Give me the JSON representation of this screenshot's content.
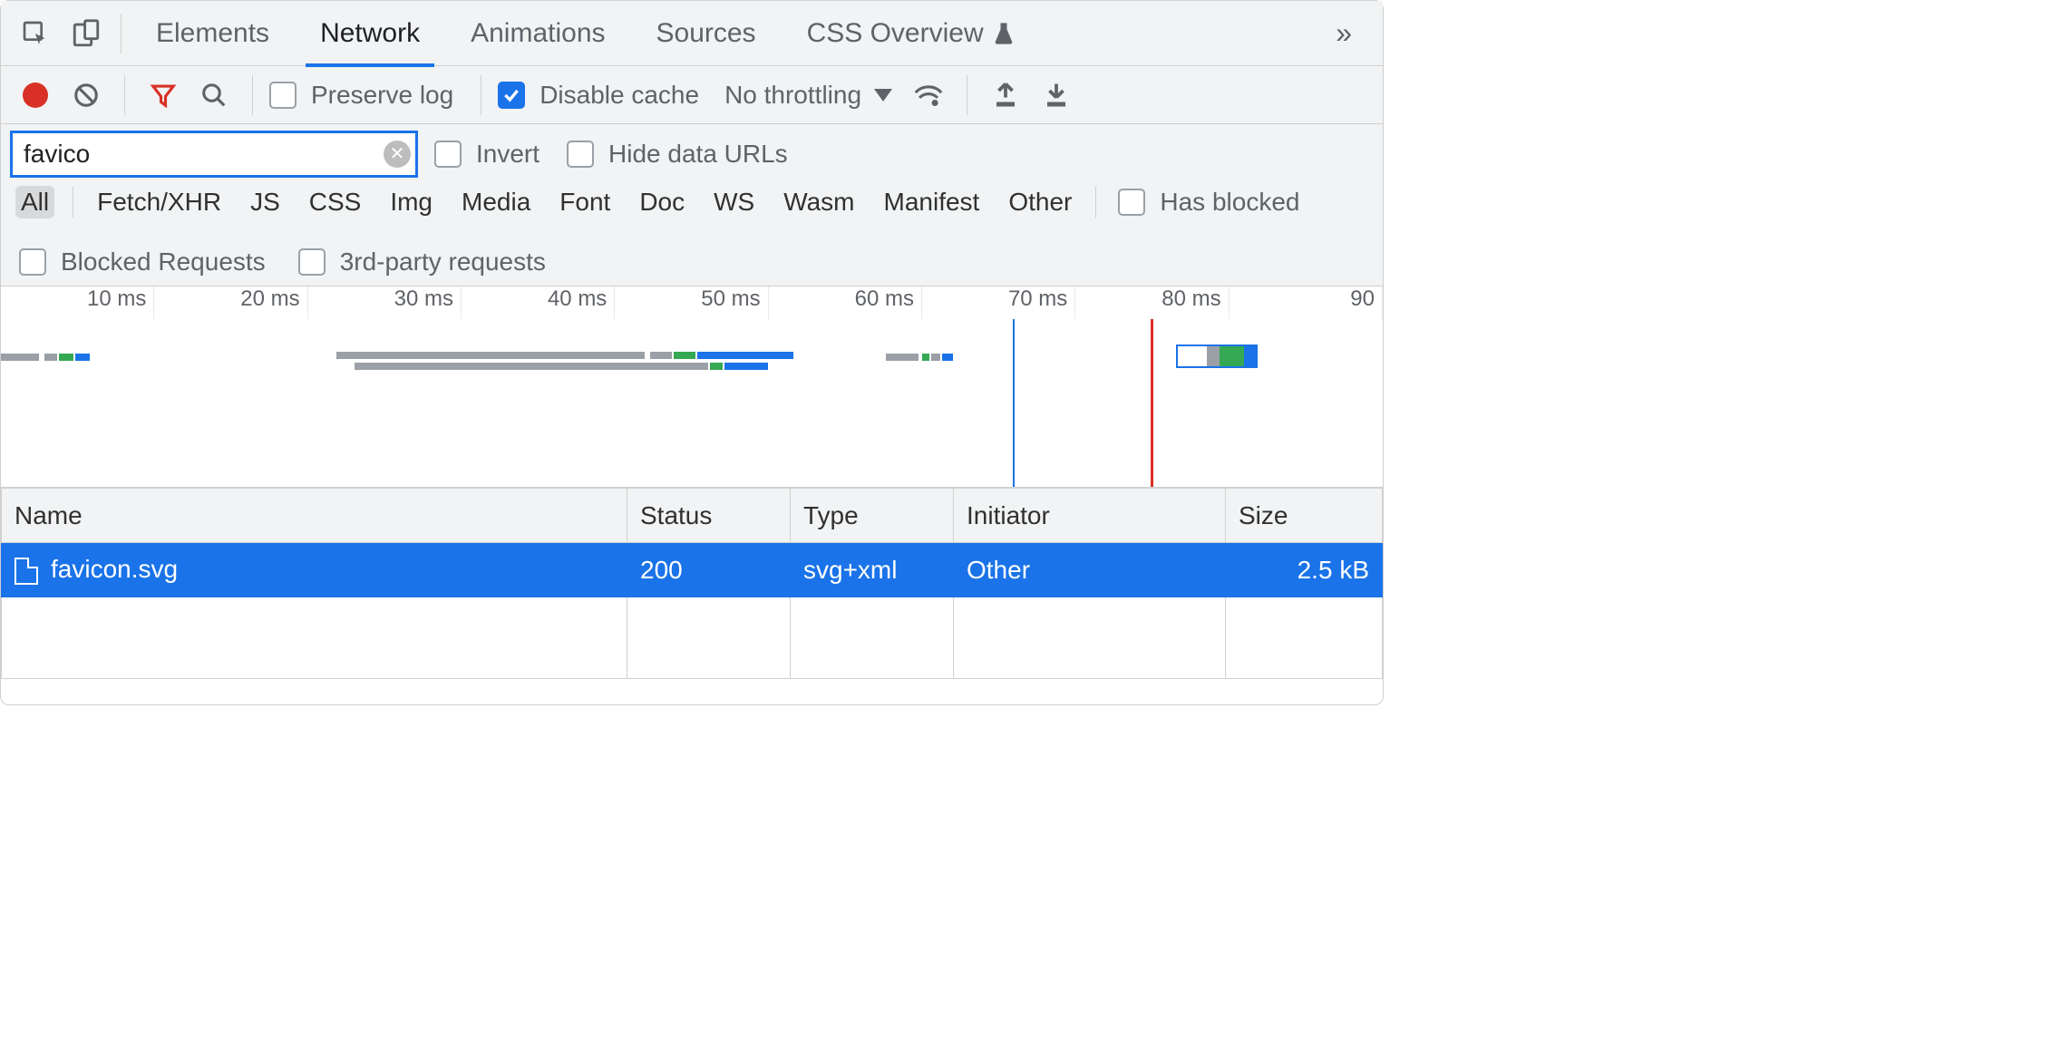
{
  "tabs": {
    "items": [
      "Elements",
      "Network",
      "Animations",
      "Sources",
      "CSS Overview"
    ],
    "active_index": 1
  },
  "toolbar": {
    "preserve_log_label": "Preserve log",
    "preserve_log_checked": false,
    "disable_cache_label": "Disable cache",
    "disable_cache_checked": true,
    "throttling_label": "No throttling"
  },
  "filter": {
    "value": "favico",
    "invert_label": "Invert",
    "invert_checked": false,
    "hide_data_urls_label": "Hide data URLs",
    "hide_data_urls_checked": false
  },
  "type_filters": {
    "items": [
      "All",
      "Fetch/XHR",
      "JS",
      "CSS",
      "Img",
      "Media",
      "Font",
      "Doc",
      "WS",
      "Wasm",
      "Manifest",
      "Other"
    ],
    "active_index": 0,
    "has_blocked_label": "Has blocked",
    "blocked_requests_label": "Blocked Requests",
    "third_party_label": "3rd-party requests"
  },
  "timeline": {
    "ticks": [
      "10 ms",
      "20 ms",
      "30 ms",
      "40 ms",
      "50 ms",
      "60 ms",
      "70 ms",
      "80 ms",
      "90 "
    ]
  },
  "table": {
    "columns": [
      "Name",
      "Status",
      "Type",
      "Initiator",
      "Size"
    ],
    "rows": [
      {
        "name": "favicon.svg",
        "status": "200",
        "type": "svg+xml",
        "initiator": "Other",
        "size": "2.5 kB",
        "selected": true
      }
    ]
  }
}
